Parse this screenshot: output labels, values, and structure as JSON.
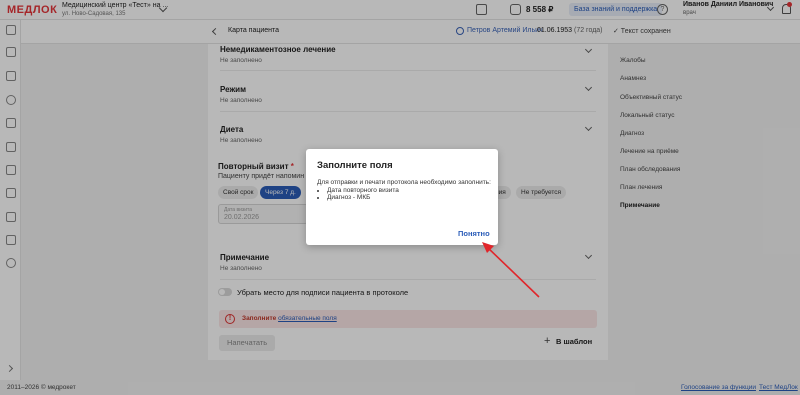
{
  "topbar": {
    "logo": "МЕДЛОК",
    "org_name": "Медицинский центр «Тест» на ...",
    "org_address": "ул. Ново-Садовая, 135",
    "balance": "8 558 ₽",
    "kb_button": "База знаний и поддержка",
    "help_icon_glyph": "?",
    "user_name": "Иванов Даниил Иванович",
    "user_role": "врач"
  },
  "subheader": {
    "title": "Карта пациента",
    "patient_name": "Петров Артемий Ильич",
    "patient_dob": "01.06.1953",
    "patient_age": "(72 года)",
    "save_status": "✓ Текст сохранен"
  },
  "sections": [
    {
      "title": "Немедикаментозное лечение",
      "value": "Не заполнено"
    },
    {
      "title": "Режим",
      "value": "Не заполнено"
    },
    {
      "title": "Диета",
      "value": "Не заполнено"
    }
  ],
  "repeat_visit": {
    "title": "Повторный визит",
    "required_mark": "*",
    "description": "Пациенту придёт напомин",
    "chips": [
      "Свой срок",
      "Через 7 д.",
      "ния",
      "Не требуется"
    ],
    "date_label": "Дата визита",
    "date_value": "20.02.2026"
  },
  "note": {
    "title": "Примечание",
    "value": "Не заполнено"
  },
  "toggle_label": "Убрать место для подписи пациента в протоколе",
  "alert": {
    "icon_glyph": "!",
    "text": "Заполните ",
    "link": "обязательные поля"
  },
  "buttons": {
    "apply": "Напечатать",
    "template_plus": "+",
    "template": "В шаблон"
  },
  "right_nav": [
    "Жалобы",
    "Анамнез",
    "Объективный статус",
    "Локальный статус",
    "Диагноз",
    "Лечение на приёме",
    "План обследования",
    "План лечения",
    "Примечание"
  ],
  "modal": {
    "title": "Заполните поля",
    "body": "Для отправки и печати протокола необходимо заполнить:",
    "items": [
      "Дата повторного визита",
      "Диагноз - МКБ"
    ],
    "ok": "Понятно"
  },
  "footer": {
    "copyright": "2011–2026 © медрокет",
    "link1": "Голосование за функции",
    "link2": "Тест МедЛок"
  },
  "colors": {
    "accent": "#2a5cb8",
    "brand": "#e5353a",
    "arrow": "#e0262b"
  }
}
